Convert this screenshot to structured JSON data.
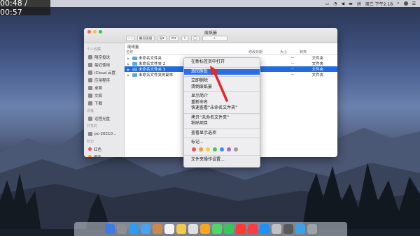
{
  "overlay": {
    "time": "00:48 / 00:57"
  },
  "menubar": {
    "clock": "周三 下午2:18"
  },
  "window": {
    "title": "废纸篓",
    "path": "废纸篓",
    "columns": {
      "name": "名称",
      "date": "修改日期",
      "size": "大小",
      "kind": "种类"
    },
    "rows": [
      {
        "name": "未命名文件夹",
        "date": "",
        "size": "--",
        "kind": "文件夹",
        "selected": false
      },
      {
        "name": "未命名文件夹 2",
        "date": "",
        "size": "--",
        "kind": "文件夹",
        "selected": false
      },
      {
        "name": "未命名文件夹 3",
        "date": "",
        "size": "--",
        "kind": "文件夹",
        "selected": true
      },
      {
        "name": "未命名文件夹的副本",
        "date": "",
        "size": "--",
        "kind": "文件夹",
        "selected": false
      }
    ]
  },
  "sidebar": {
    "section_favorites": "个人收藏",
    "favorites": [
      "隔空投送",
      "最近使用",
      "iCloud 云盘",
      "应用程序",
      "桌面",
      "文稿",
      "下载"
    ],
    "section_devices": "设备",
    "devices": [
      "远程光盘"
    ],
    "section_shared": "共享的",
    "shared": [
      "pc-20210..."
    ],
    "section_tags": "标记",
    "tags": [
      "红色",
      "橙色"
    ]
  },
  "context_menu": {
    "items": {
      "open_new_tab": "在新标签页中打开",
      "put_back": "放回原处",
      "delete_now": "立即删除",
      "empty_trash": "清倒废纸篓",
      "get_info": "显示简介",
      "rename": "重新命名",
      "quicklook": "快速查看“未命名文件夹”",
      "copy": "拷贝“未命名文件夹”",
      "paste": "粘贴项目",
      "view_options": "查看显示选项",
      "tags": "标记...",
      "services": "文件夹操作设置..."
    },
    "tag_colors": [
      "#f0524f",
      "#f59a2e",
      "#f5cf3a",
      "#52c05a",
      "#3b8df0",
      "#b061d8",
      "#9b9b9b"
    ]
  },
  "colors": {
    "selection": "#2a6fe8",
    "arrow": "#e8262a"
  }
}
